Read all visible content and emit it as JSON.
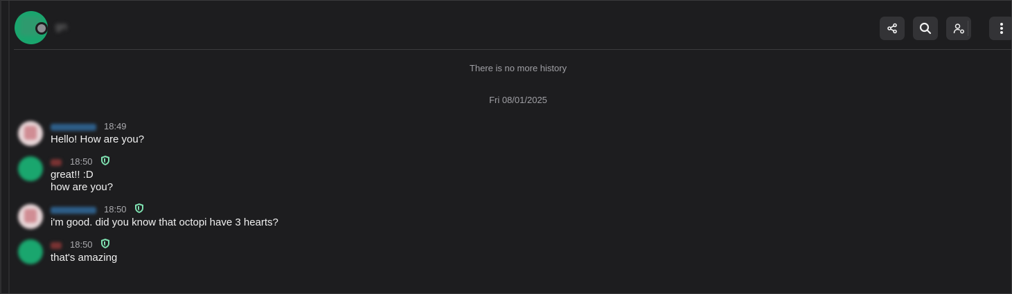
{
  "header": {
    "room_name": "gn",
    "buttons": [
      {
        "name": "share-button",
        "icon": "share-icon"
      },
      {
        "name": "search-button",
        "icon": "search-icon"
      },
      {
        "name": "people-button",
        "icon": "user-settings-icon"
      },
      {
        "name": "more-options-button",
        "icon": "kebab-icon"
      }
    ]
  },
  "timeline": {
    "no_history": "There is no more history",
    "date_separator": "Fri 08/01/2025",
    "messages": [
      {
        "sender": "songbirds",
        "time": "18:49",
        "text": "Hello! How are you?",
        "verified": false
      },
      {
        "sender": "gn",
        "time": "18:50",
        "text": "great!! :D\nhow are you?",
        "verified": true
      },
      {
        "sender": "songbirds",
        "time": "18:50",
        "text": "i'm good. did you know that octopi have 3 hearts?",
        "verified": true
      },
      {
        "sender": "gn",
        "time": "18:50",
        "text": "that's amazing",
        "verified": true
      }
    ]
  },
  "colors": {
    "background": "#1d1d1f",
    "accent_green": "#1aa66e",
    "shield_green": "#7ee0b0"
  }
}
